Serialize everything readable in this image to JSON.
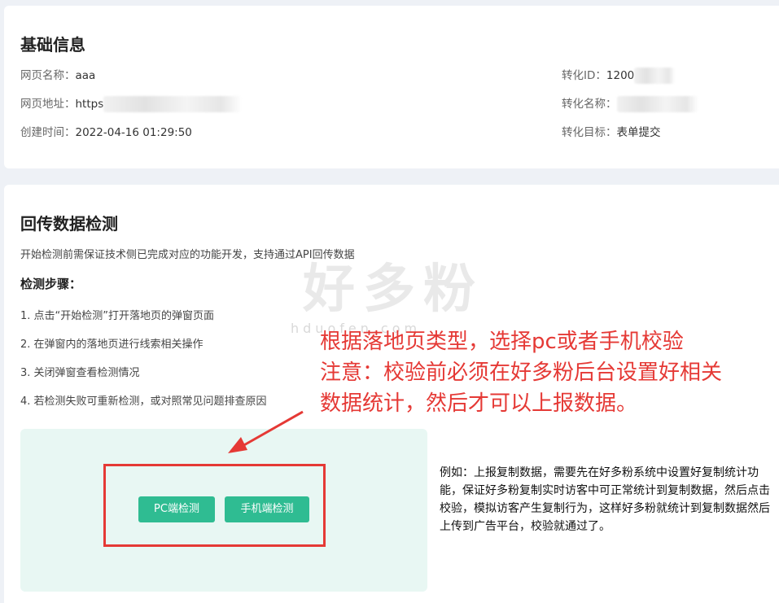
{
  "basic_info": {
    "title": "基础信息",
    "page_name_label": "网页名称：",
    "page_name_value": "aaa",
    "page_url_label": "网页地址：",
    "page_url_value": "https",
    "created_label": "创建时间：",
    "created_value": "2022-04-16 01:29:50",
    "conversion_id_label": "转化ID：",
    "conversion_id_value": "1200",
    "conversion_name_label": "转化名称：",
    "conversion_goal_label": "转化目标：",
    "conversion_goal_value": "表单提交"
  },
  "data_check": {
    "title": "回传数据检测",
    "description": "开始检测前需保证技术侧已完成对应的功能开发，支持通过API回传数据",
    "steps_title": "检测步骤：",
    "steps": [
      "1. 点击“开始检测”打开落地页的弹窗页面",
      "2. 在弹窗内的落地页进行线索相关操作",
      "3. 关闭弹窗查看检测情况",
      "4. 若检测失败可重新检测，或对照常见问题排查原因"
    ],
    "pc_button": "PC端检测",
    "mobile_button": "手机端检测"
  },
  "annotation": {
    "lines": [
      "根据落地页类型，选择pc或者手机校验",
      "注意：校验前必须在好多粉后台设置好相关",
      "数据统计，然后才可以上报数据。"
    ],
    "example": "例如：上报复制数据，需要先在好多粉系统中设置好复制统计功能，保证好多粉复制实时访客中可正常统计到复制数据，然后点击校验，模拟访客产生复制行为，这样好多粉就统计到复制数据然后上传到广告平台，校验就通过了。",
    "watermark": "好多粉",
    "watermark_sub": "hduofen.com"
  },
  "colors": {
    "accent_green": "#2fbc92",
    "annotation_red": "#e53935",
    "panel_bg": "#e8f7f3"
  }
}
